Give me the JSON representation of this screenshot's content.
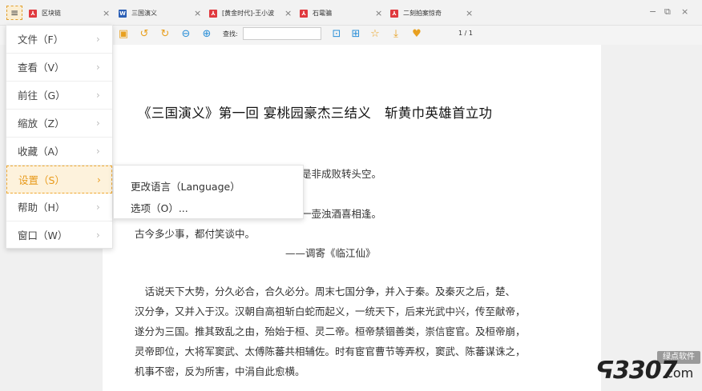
{
  "tabbar": {
    "menu_icon": "≡",
    "tabs": [
      {
        "label": "区块链",
        "icon": "pdf-icon",
        "glyph": "⅄"
      },
      {
        "label": "三国演义",
        "icon": "word-icon",
        "glyph": "W"
      },
      {
        "label": "[黄金时代]-王小波",
        "icon": "pdf-icon",
        "glyph": "⅄"
      },
      {
        "label": "石鼋骗",
        "icon": "pdf-icon",
        "glyph": "⅄"
      },
      {
        "label": "二刻拍案惊奇",
        "icon": "pdf-icon",
        "glyph": "⅄"
      }
    ],
    "close_glyph": "×",
    "window_controls": {
      "minimize": "−",
      "restore": "⧉",
      "close": "×"
    }
  },
  "toolbar": {
    "find_label": "查找:",
    "find_value": "",
    "page_indicator": "1 / 1"
  },
  "main_menu": {
    "items": [
      {
        "label": "文件（F）"
      },
      {
        "label": "查看（V）"
      },
      {
        "label": "前往（G）"
      },
      {
        "label": "缩放（Z）"
      },
      {
        "label": "收藏（A）"
      },
      {
        "label": "设置（S）",
        "active": true
      },
      {
        "label": "帮助（H）"
      },
      {
        "label": "窗口（W）"
      }
    ],
    "arrow": "›"
  },
  "sub_menu": {
    "items": [
      {
        "label": "更改语言（Language）"
      },
      {
        "label": "选项（O）..."
      }
    ]
  },
  "document": {
    "title": "《三国演义》第一回 宴桃园豪杰三结义　斩黄巾英雄首立功",
    "poem_line1": "是非成败转头空。",
    "poem_line2": "一壶浊酒喜相逢。",
    "poem_line3": "古今多少事，都付笑谈中。",
    "poem_attr": "——调寄《临江仙》",
    "para": [
      "　话说天下大势，分久必合，合久必分。周末七国分争，并入于秦。及秦灭之后，楚、",
      "汉分争，又并入于汉。汉朝自高祖斩白蛇而起义，一统天下，后来光武中兴，传至献帝，",
      "遂分为三国。推其致乱之由，殆始于桓、灵二帝。桓帝禁锢善类，崇信宦官。及桓帝崩，",
      "灵帝即位，大将军窦武、太傅陈蕃共相辅佐。时有宦官曹节等弄权，窦武、陈蕃谋诛之，",
      "机事不密，反为所害，中涓自此愈横。"
    ]
  },
  "watermark": {
    "badge": "绿点软件",
    "logo": "ᕋ3307",
    "com": ".com"
  },
  "colors": {
    "accent": "#e89a1a",
    "active_bg": "#fdf2dc",
    "pdf_red": "#e0393e",
    "word_blue": "#2b5fb5"
  }
}
